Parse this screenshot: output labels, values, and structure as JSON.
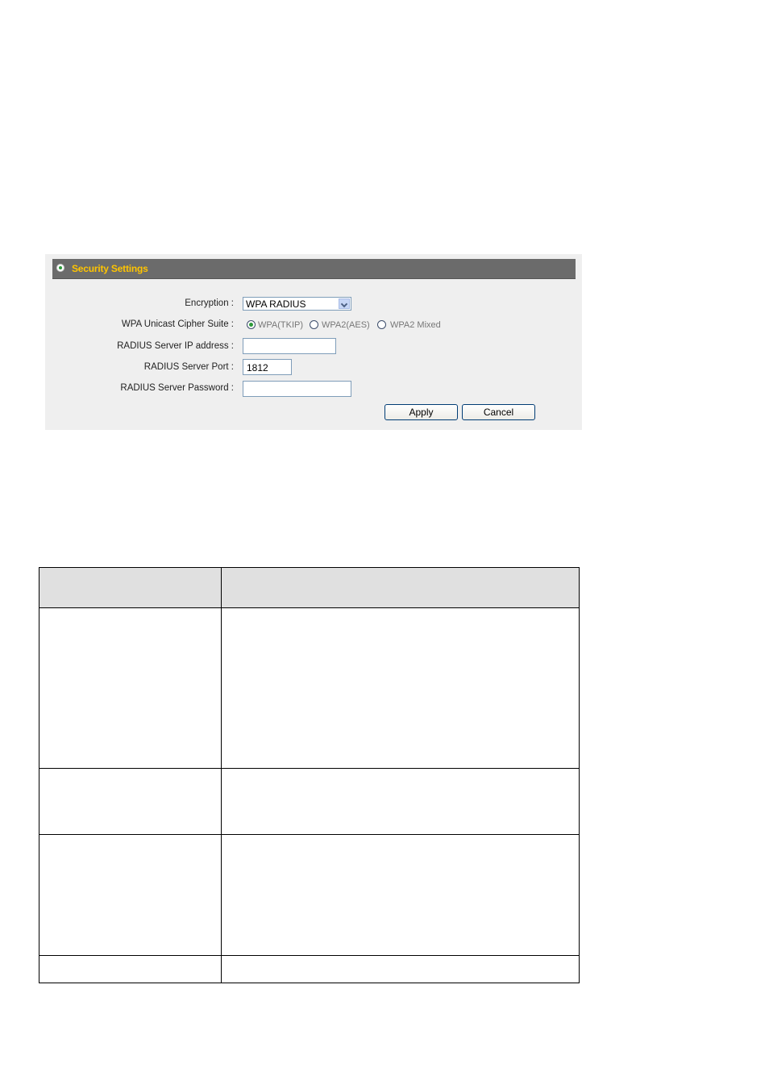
{
  "panel": {
    "title": "Security Settings",
    "encryption": {
      "label": "Encryption :",
      "value": "WPA RADIUS"
    },
    "cipher_suite": {
      "label": "WPA Unicast Cipher Suite :",
      "options": [
        {
          "label": "WPA(TKIP)",
          "selected": true
        },
        {
          "label": "WPA2(AES)",
          "selected": false
        },
        {
          "label": "WPA2 Mixed",
          "selected": false
        }
      ]
    },
    "radius_ip": {
      "label": "RADIUS Server IP address :",
      "value": ""
    },
    "radius_port": {
      "label": "RADIUS Server Port :",
      "value": "1812"
    },
    "radius_password": {
      "label": "RADIUS Server Password :",
      "value": ""
    },
    "apply_label": "Apply",
    "cancel_label": "Cancel"
  },
  "table": {
    "headers": [
      "",
      ""
    ],
    "rows": [
      [
        "",
        ""
      ],
      [
        "",
        ""
      ],
      [
        "",
        ""
      ],
      [
        "",
        ""
      ]
    ]
  },
  "colors": {
    "panel_bg": "#efefef",
    "header_bg": "#6b6b6b",
    "header_text": "#ffc400",
    "radio_selected": "#2c9a3a"
  }
}
